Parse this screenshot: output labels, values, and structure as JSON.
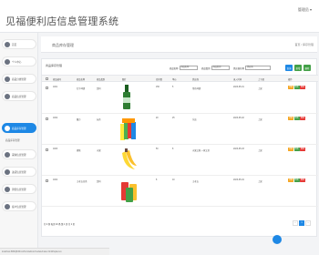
{
  "app": {
    "title": "见福便利店信息管理系统",
    "user_menu": "管理员 ▾"
  },
  "sidebar": {
    "items": [
      {
        "label": "首页"
      },
      {
        "label": "个人中心"
      },
      {
        "label": "商品分类管理"
      },
      {
        "label": "商品信息管理"
      },
      {
        "label": "商品库存管理"
      },
      {
        "label": "采购信息管理"
      },
      {
        "label": "进货信息管理"
      },
      {
        "label": "销售信息管理"
      },
      {
        "label": "客户信息管理"
      }
    ],
    "sub_label": "商品库存管理"
  },
  "panel": {
    "title": "商品库存管理",
    "breadcrumb": "首页 / 库存管理"
  },
  "content": {
    "subtitle": "商品库存管理",
    "filters": [
      {
        "label": "商品名称",
        "value": "商品名称"
      },
      {
        "label": "商品类别",
        "value": "商品类别"
      },
      {
        "label": "供应商名称",
        "value": "供应商"
      }
    ],
    "search_button": "查询",
    "add_button": "新增",
    "delete_button": "删除"
  },
  "table": {
    "columns": [
      "商品编号",
      "商品名称",
      "商品类别",
      "图片",
      "库存数",
      "单价",
      "供应商",
      "录入时间",
      "上下架",
      "操作"
    ],
    "rows": [
      {
        "id": "1001",
        "name": "红牛啤酒",
        "category": "饮料",
        "stock": "156",
        "price": "5",
        "supplier": "雪花啤酒",
        "date": "2023-05-01",
        "status": "上架"
      },
      {
        "id": "1002",
        "name": "魔方",
        "category": "玩具",
        "stock": "20",
        "price": "25",
        "supplier": "乐高",
        "date": "2023-05-02",
        "status": "上架"
      },
      {
        "id": "1003",
        "name": "香蕉",
        "category": "水果",
        "stock": "50",
        "price": "8",
        "supplier": "水果之家,一家之美",
        "date": "2023-05-03",
        "status": "上架"
      },
      {
        "id": "1004",
        "name": "王老吉凉茶",
        "category": "饮料",
        "stock": "8",
        "price": "10",
        "supplier": "王老吉",
        "date": "2023-05-04",
        "status": "上架"
      }
    ],
    "ops": [
      "详情",
      "修改",
      "删除"
    ]
  },
  "pager": {
    "info": "共 4 条 每页 10 条 第 1 页 共 1 页",
    "current": "1"
  },
  "status_bar": {
    "url": "localhost:8080/jfbl/front/front/admin/module/index.html#/spkucun"
  }
}
